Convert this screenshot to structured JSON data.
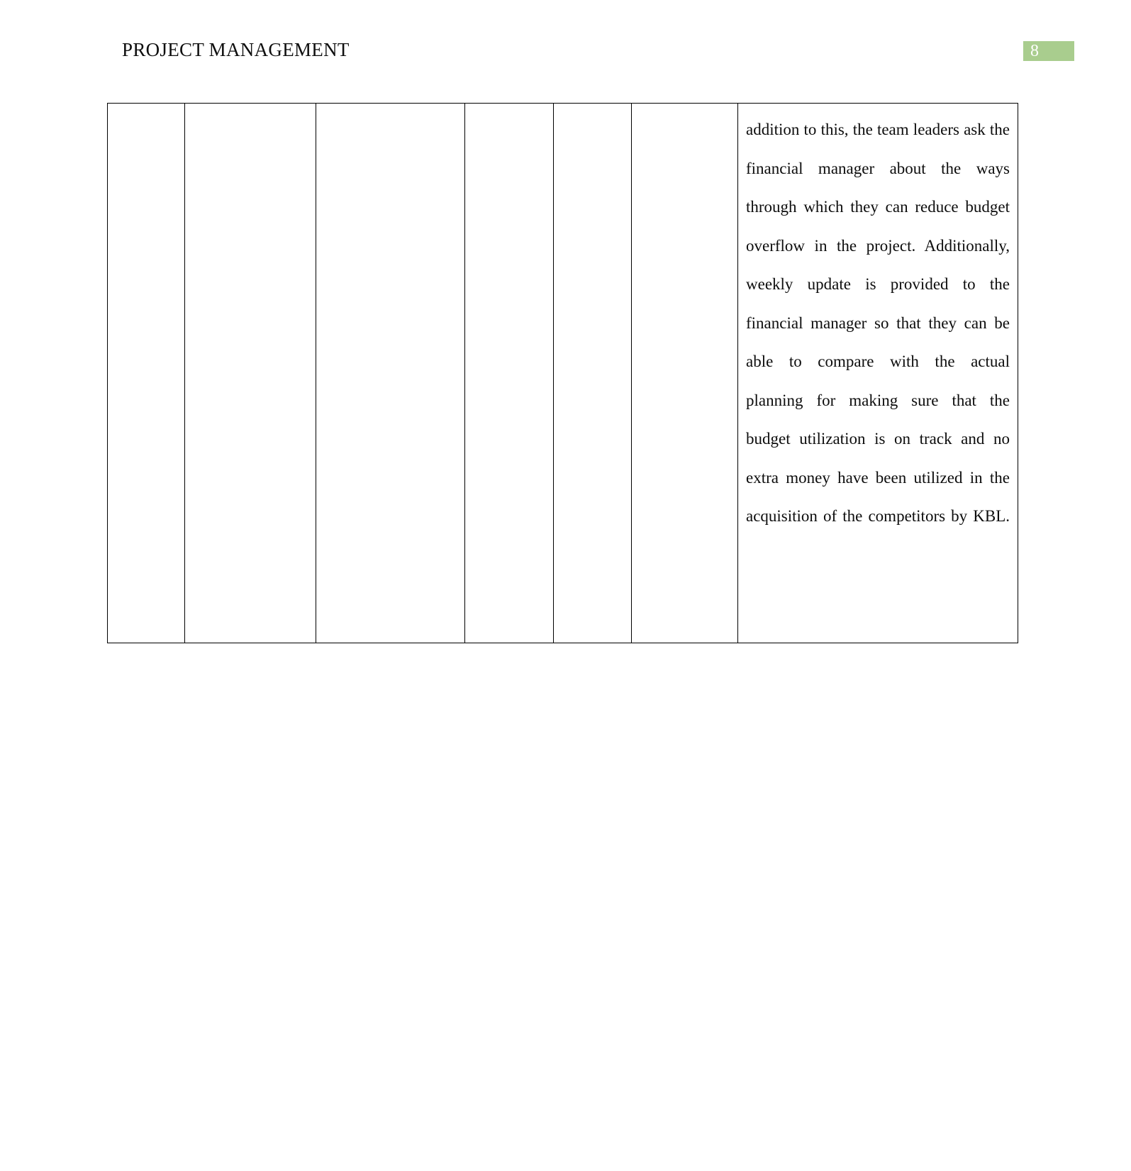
{
  "document": {
    "header": {
      "title": "PROJECT MANAGEMENT",
      "page_number": "8",
      "badge_color": "#a9cd8e",
      "page_number_color": "#ffffff"
    },
    "table": {
      "columns": 7,
      "rows": [
        {
          "cells": [
            {
              "text": ""
            },
            {
              "text": ""
            },
            {
              "text": ""
            },
            {
              "text": ""
            },
            {
              "text": ""
            },
            {
              "text": ""
            },
            {
              "text": "addition to this, the team leaders ask the financial manager about the ways through which they can reduce budget overflow in the project. Additionally, weekly update is provided to the financial manager so that they can be able to compare with the actual planning for making sure that the budget utilization is on track and no extra money have been utilized in the acquisition of the competitors by KBL."
            }
          ]
        }
      ]
    }
  }
}
